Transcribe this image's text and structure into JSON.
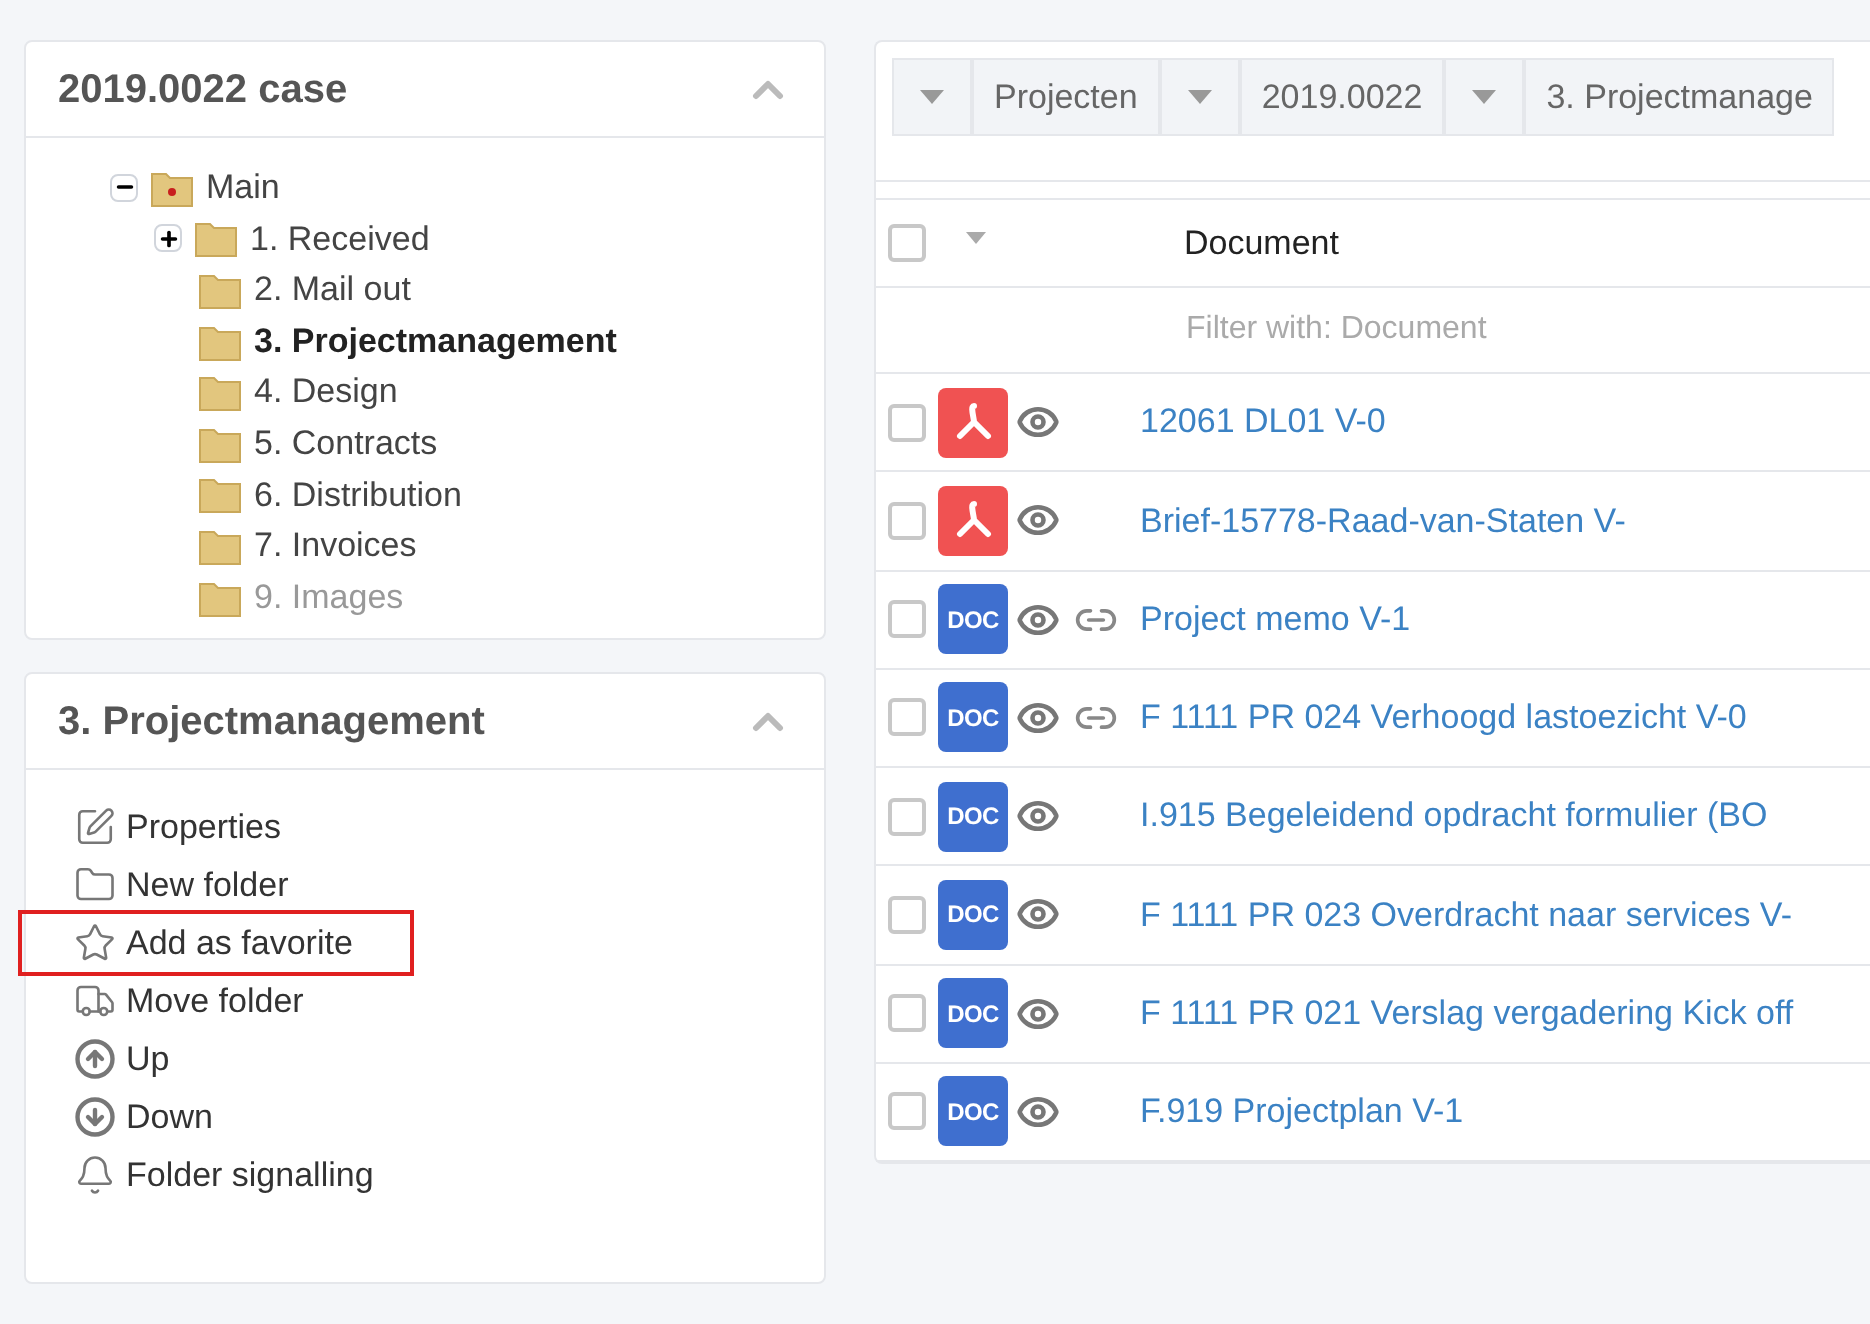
{
  "tree_panel": {
    "title": "2019.0022 case",
    "collapsed": false,
    "root": {
      "label": "Main",
      "expanded": true,
      "selected": false,
      "disabled": false,
      "children": [
        {
          "label": "1. Received",
          "expanded": false,
          "selected": false,
          "disabled": false
        },
        {
          "label": "2. Mail out",
          "selected": false,
          "disabled": false
        },
        {
          "label": "3. Projectmanagement",
          "selected": true,
          "disabled": false
        },
        {
          "label": "4. Design",
          "selected": false,
          "disabled": false
        },
        {
          "label": "5. Contracts",
          "selected": false,
          "disabled": false
        },
        {
          "label": "6. Distribution",
          "selected": false,
          "disabled": false
        },
        {
          "label": "7. Invoices",
          "selected": false,
          "disabled": false
        },
        {
          "label": "9. Images",
          "selected": false,
          "disabled": true
        }
      ]
    }
  },
  "actions_panel": {
    "title": "3. Projectmanagement",
    "collapsed": false,
    "items": [
      {
        "label": "Properties",
        "kind": "edit",
        "highlighted": false
      },
      {
        "label": "New folder",
        "kind": "folder",
        "highlighted": false
      },
      {
        "label": "Add as favorite",
        "kind": "star",
        "highlighted": true
      },
      {
        "label": "Move folder",
        "kind": "truck",
        "highlighted": false
      },
      {
        "label": "Up",
        "kind": "up",
        "highlighted": false
      },
      {
        "label": "Down",
        "kind": "down",
        "highlighted": false
      },
      {
        "label": "Folder signalling",
        "kind": "bell",
        "highlighted": false
      }
    ]
  },
  "breadcrumb": [
    "Projecten",
    "2019.0022",
    "3. Projectmanage"
  ],
  "table": {
    "column": "Document",
    "all_checked": false,
    "filter_placeholder": "Filter with: Document",
    "rows": [
      {
        "kind": "pdf",
        "linked": false,
        "checked": false,
        "name": "12061 DL01 V-0"
      },
      {
        "kind": "pdf",
        "linked": false,
        "checked": false,
        "name": "Brief-15778-Raad-van-Staten V-"
      },
      {
        "kind": "doc",
        "badge": "DOC",
        "linked": true,
        "checked": false,
        "name": "Project memo V-1"
      },
      {
        "kind": "doc",
        "badge": "DOC",
        "linked": true,
        "checked": false,
        "name": "F 1111 PR 024 Verhoogd lastoezicht V-0"
      },
      {
        "kind": "doc",
        "badge": "DOC",
        "linked": false,
        "checked": false,
        "name": "I.915 Begeleidend opdracht formulier (BO"
      },
      {
        "kind": "doc",
        "badge": "DOC",
        "linked": false,
        "checked": false,
        "name": "F 1111 PR 023 Overdracht naar services V-"
      },
      {
        "kind": "doc",
        "badge": "DOC",
        "linked": false,
        "checked": false,
        "name": "F 1111 PR 021 Verslag vergadering Kick off"
      },
      {
        "kind": "doc",
        "badge": "DOC",
        "linked": false,
        "checked": false,
        "name": "F.919 Projectplan V-1"
      }
    ]
  }
}
